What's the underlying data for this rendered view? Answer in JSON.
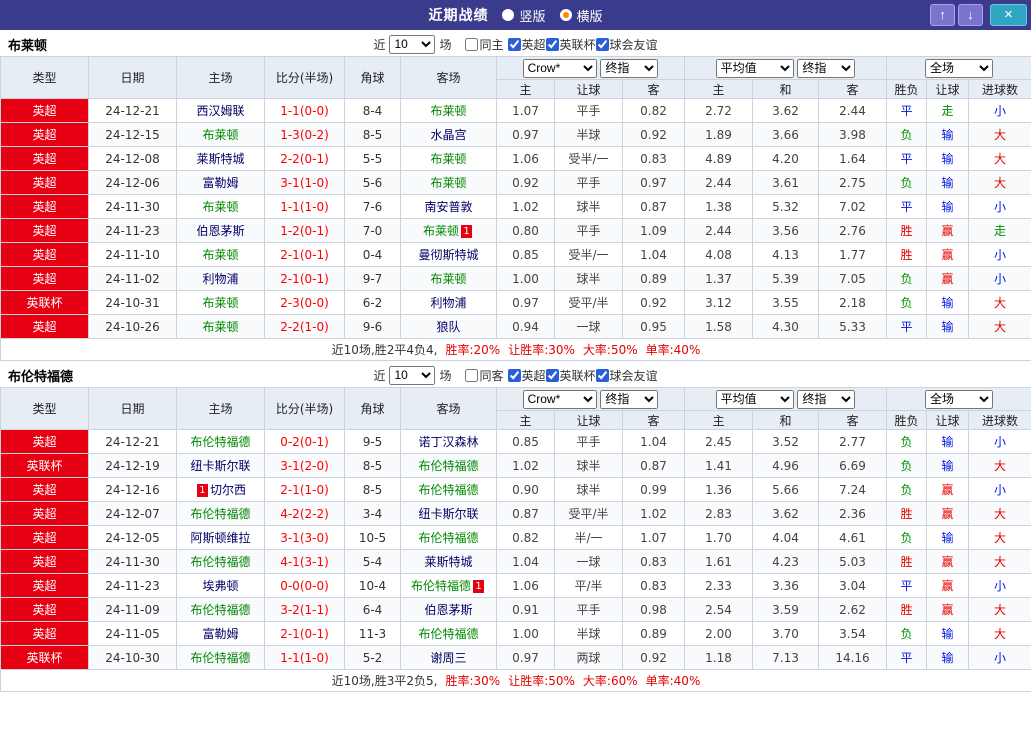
{
  "topbar": {
    "title": "近期战绩",
    "layout_options": [
      {
        "label": "竖版",
        "selected": false
      },
      {
        "label": "横版",
        "selected": true
      }
    ],
    "up_icon": "↑",
    "down_icon": "↓",
    "close_icon": "×"
  },
  "colors": {
    "header_bar": "#3b3b8e",
    "nav_button": "#7b74cf",
    "close_button": "#2fa7c3",
    "league_cell_bg": "#e60012",
    "focal_team": "#008800",
    "opponent_team": "#000066",
    "score": "#ff0000",
    "win_red": "#e60000",
    "lose_blue": "#0016e0",
    "push_green": "#009000",
    "table_header_bg": "#e7edf5"
  },
  "result_color_map": {
    "胜": "red",
    "赢": "red",
    "大": "red",
    "平": "blue",
    "输": "blue",
    "小": "blue",
    "负": "green",
    "走": "green"
  },
  "sections": [
    {
      "team": "布莱顿",
      "filter": {
        "near_label": "近",
        "count": "10",
        "games_label": "场",
        "same_label": "同主",
        "same_checked": false,
        "leagues": [
          {
            "label": "英超",
            "checked": true
          },
          {
            "label": "英联杯",
            "checked": true
          },
          {
            "label": "球会友谊",
            "checked": true
          }
        ]
      },
      "header": {
        "cols": [
          "类型",
          "日期",
          "主场",
          "比分(半场)",
          "角球",
          "客场"
        ],
        "odds_company": "Crow*",
        "odds_final": "终指",
        "avg_label": "平均值",
        "avg_final": "终指",
        "full_label": "全场",
        "sub": [
          "主",
          "让球",
          "客",
          "主",
          "和",
          "客",
          "胜负",
          "让球",
          "进球数"
        ]
      },
      "rows": [
        {
          "type": "英超",
          "date": "24-12-21",
          "home": "西汉姆联",
          "score": "1-1",
          "half": "(0-0)",
          "corners": "8-4",
          "away": "布莱顿",
          "odds": [
            "1.07",
            "平手",
            "0.82"
          ],
          "avg": [
            "2.72",
            "3.62",
            "2.44"
          ],
          "results": [
            "平",
            "走",
            "小"
          ]
        },
        {
          "type": "英超",
          "date": "24-12-15",
          "home": "布莱顿",
          "score": "1-3",
          "half": "(0-2)",
          "corners": "8-5",
          "away": "水晶宫",
          "odds": [
            "0.97",
            "半球",
            "0.92"
          ],
          "avg": [
            "1.89",
            "3.66",
            "3.98"
          ],
          "results": [
            "负",
            "输",
            "大"
          ]
        },
        {
          "type": "英超",
          "date": "24-12-08",
          "home": "莱斯特城",
          "score": "2-2",
          "half": "(0-1)",
          "corners": "5-5",
          "away": "布莱顿",
          "odds": [
            "1.06",
            "受半/一",
            "0.83"
          ],
          "avg": [
            "4.89",
            "4.20",
            "1.64"
          ],
          "results": [
            "平",
            "输",
            "大"
          ]
        },
        {
          "type": "英超",
          "date": "24-12-06",
          "home": "富勒姆",
          "score": "3-1",
          "half": "(1-0)",
          "corners": "5-6",
          "away": "布莱顿",
          "odds": [
            "0.92",
            "平手",
            "0.97"
          ],
          "avg": [
            "2.44",
            "3.61",
            "2.75"
          ],
          "results": [
            "负",
            "输",
            "大"
          ]
        },
        {
          "type": "英超",
          "date": "24-11-30",
          "home": "布莱顿",
          "score": "1-1",
          "half": "(1-0)",
          "corners": "7-6",
          "away": "南安普敦",
          "odds": [
            "1.02",
            "球半",
            "0.87"
          ],
          "avg": [
            "1.38",
            "5.32",
            "7.02"
          ],
          "results": [
            "平",
            "输",
            "小"
          ]
        },
        {
          "type": "英超",
          "date": "24-11-23",
          "home": "伯恩茅斯",
          "score": "1-2",
          "half": "(0-1)",
          "corners": "7-0",
          "away": "布莱顿",
          "away_card": true,
          "odds": [
            "0.80",
            "平手",
            "1.09"
          ],
          "avg": [
            "2.44",
            "3.56",
            "2.76"
          ],
          "results": [
            "胜",
            "赢",
            "走"
          ]
        },
        {
          "type": "英超",
          "date": "24-11-10",
          "home": "布莱顿",
          "score": "2-1",
          "half": "(0-1)",
          "corners": "0-4",
          "away": "曼彻斯特城",
          "odds": [
            "0.85",
            "受半/一",
            "1.04"
          ],
          "avg": [
            "4.08",
            "4.13",
            "1.77"
          ],
          "results": [
            "胜",
            "赢",
            "小"
          ]
        },
        {
          "type": "英超",
          "date": "24-11-02",
          "home": "利物浦",
          "score": "2-1",
          "half": "(0-1)",
          "corners": "9-7",
          "away": "布莱顿",
          "odds": [
            "1.00",
            "球半",
            "0.89"
          ],
          "avg": [
            "1.37",
            "5.39",
            "7.05"
          ],
          "results": [
            "负",
            "赢",
            "小"
          ]
        },
        {
          "type": "英联杯",
          "date": "24-10-31",
          "home": "布莱顿",
          "score": "2-3",
          "half": "(0-0)",
          "corners": "6-2",
          "away": "利物浦",
          "odds": [
            "0.97",
            "受平/半",
            "0.92"
          ],
          "avg": [
            "3.12",
            "3.55",
            "2.18"
          ],
          "results": [
            "负",
            "输",
            "大"
          ]
        },
        {
          "type": "英超",
          "date": "24-10-26",
          "home": "布莱顿",
          "score": "2-2",
          "half": "(1-0)",
          "corners": "9-6",
          "away": "狼队",
          "odds": [
            "0.94",
            "一球",
            "0.95"
          ],
          "avg": [
            "1.58",
            "4.30",
            "5.33"
          ],
          "results": [
            "平",
            "输",
            "大"
          ]
        }
      ],
      "summary": {
        "prefix": "近10场,胜2平4负4,",
        "stats": [
          "胜率:20%",
          "让胜率:30%",
          "大率:50%",
          "单率:40%"
        ]
      }
    },
    {
      "team": "布伦特福德",
      "filter": {
        "near_label": "近",
        "count": "10",
        "games_label": "场",
        "same_label": "同客",
        "same_checked": false,
        "leagues": [
          {
            "label": "英超",
            "checked": true
          },
          {
            "label": "英联杯",
            "checked": true
          },
          {
            "label": "球会友谊",
            "checked": true
          }
        ]
      },
      "header": {
        "cols": [
          "类型",
          "日期",
          "主场",
          "比分(半场)",
          "角球",
          "客场"
        ],
        "odds_company": "Crow*",
        "odds_final": "终指",
        "avg_label": "平均值",
        "avg_final": "终指",
        "full_label": "全场",
        "sub": [
          "主",
          "让球",
          "客",
          "主",
          "和",
          "客",
          "胜负",
          "让球",
          "进球数"
        ]
      },
      "rows": [
        {
          "type": "英超",
          "date": "24-12-21",
          "home": "布伦特福德",
          "score": "0-2",
          "half": "(0-1)",
          "corners": "9-5",
          "away": "诺丁汉森林",
          "odds": [
            "0.85",
            "平手",
            "1.04"
          ],
          "avg": [
            "2.45",
            "3.52",
            "2.77"
          ],
          "results": [
            "负",
            "输",
            "小"
          ]
        },
        {
          "type": "英联杯",
          "date": "24-12-19",
          "home": "纽卡斯尔联",
          "score": "3-1",
          "half": "(2-0)",
          "corners": "8-5",
          "away": "布伦特福德",
          "odds": [
            "1.02",
            "球半",
            "0.87"
          ],
          "avg": [
            "1.41",
            "4.96",
            "6.69"
          ],
          "results": [
            "负",
            "输",
            "大"
          ]
        },
        {
          "type": "英超",
          "date": "24-12-16",
          "home": "切尔西",
          "home_card": true,
          "score": "2-1",
          "half": "(1-0)",
          "corners": "8-5",
          "away": "布伦特福德",
          "odds": [
            "0.90",
            "球半",
            "0.99"
          ],
          "avg": [
            "1.36",
            "5.66",
            "7.24"
          ],
          "results": [
            "负",
            "赢",
            "小"
          ]
        },
        {
          "type": "英超",
          "date": "24-12-07",
          "home": "布伦特福德",
          "score": "4-2",
          "half": "(2-2)",
          "corners": "3-4",
          "away": "纽卡斯尔联",
          "odds": [
            "0.87",
            "受平/半",
            "1.02"
          ],
          "avg": [
            "2.83",
            "3.62",
            "2.36"
          ],
          "results": [
            "胜",
            "赢",
            "大"
          ]
        },
        {
          "type": "英超",
          "date": "24-12-05",
          "home": "阿斯顿维拉",
          "score": "3-1",
          "half": "(3-0)",
          "corners": "10-5",
          "away": "布伦特福德",
          "odds": [
            "0.82",
            "半/一",
            "1.07"
          ],
          "avg": [
            "1.70",
            "4.04",
            "4.61"
          ],
          "results": [
            "负",
            "输",
            "大"
          ]
        },
        {
          "type": "英超",
          "date": "24-11-30",
          "home": "布伦特福德",
          "score": "4-1",
          "half": "(3-1)",
          "corners": "5-4",
          "away": "莱斯特城",
          "odds": [
            "1.04",
            "一球",
            "0.83"
          ],
          "avg": [
            "1.61",
            "4.23",
            "5.03"
          ],
          "results": [
            "胜",
            "赢",
            "大"
          ]
        },
        {
          "type": "英超",
          "date": "24-11-23",
          "home": "埃弗顿",
          "score": "0-0",
          "half": "(0-0)",
          "corners": "10-4",
          "away": "布伦特福德",
          "away_card": true,
          "odds": [
            "1.06",
            "平/半",
            "0.83"
          ],
          "avg": [
            "2.33",
            "3.36",
            "3.04"
          ],
          "results": [
            "平",
            "赢",
            "小"
          ]
        },
        {
          "type": "英超",
          "date": "24-11-09",
          "home": "布伦特福德",
          "score": "3-2",
          "half": "(1-1)",
          "corners": "6-4",
          "away": "伯恩茅斯",
          "odds": [
            "0.91",
            "平手",
            "0.98"
          ],
          "avg": [
            "2.54",
            "3.59",
            "2.62"
          ],
          "results": [
            "胜",
            "赢",
            "大"
          ]
        },
        {
          "type": "英超",
          "date": "24-11-05",
          "home": "富勒姆",
          "score": "2-1",
          "half": "(0-1)",
          "corners": "11-3",
          "away": "布伦特福德",
          "odds": [
            "1.00",
            "半球",
            "0.89"
          ],
          "avg": [
            "2.00",
            "3.70",
            "3.54"
          ],
          "results": [
            "负",
            "输",
            "大"
          ]
        },
        {
          "type": "英联杯",
          "date": "24-10-30",
          "home": "布伦特福德",
          "score": "1-1",
          "half": "(1-0)",
          "corners": "5-2",
          "away": "谢周三",
          "odds": [
            "0.97",
            "两球",
            "0.92"
          ],
          "avg": [
            "1.18",
            "7.13",
            "14.16"
          ],
          "results": [
            "平",
            "输",
            "小"
          ]
        }
      ],
      "summary": {
        "prefix": "近10场,胜3平2负5,",
        "stats": [
          "胜率:30%",
          "让胜率:50%",
          "大率:60%",
          "单率:40%"
        ]
      }
    }
  ]
}
